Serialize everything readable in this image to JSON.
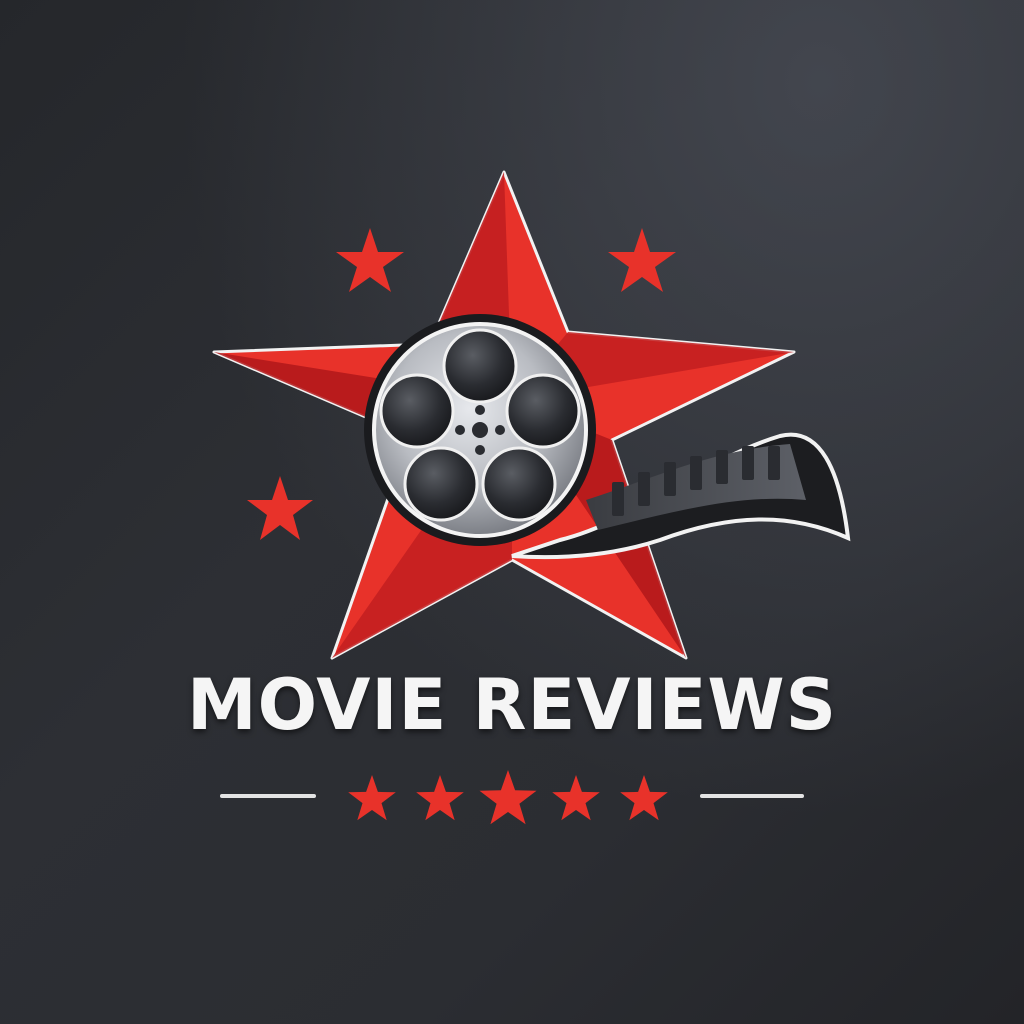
{
  "logo": {
    "title": "MOVIE REVIEWS",
    "rating_stars": 5,
    "icon": "film-reel-star-icon"
  },
  "colors": {
    "background": "#2a2c31",
    "star_red": "#e8322a",
    "star_dark_red": "#b0171a",
    "reel_silver": "#b9bcc2",
    "text": "#f5f5f5"
  }
}
